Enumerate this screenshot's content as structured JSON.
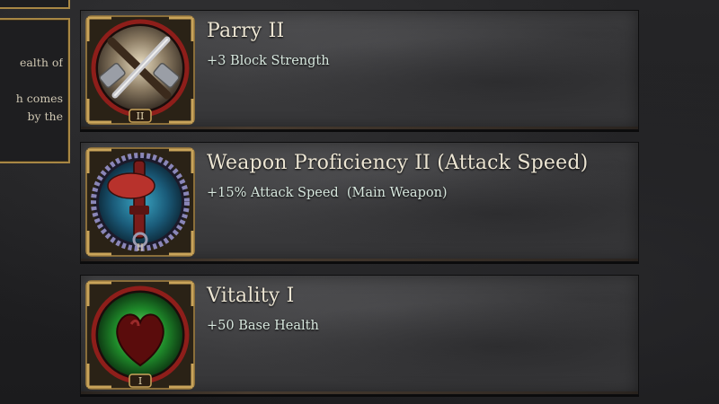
{
  "side_panel": {
    "lines": [
      "ealth of",
      "",
      "h comes",
      "by the"
    ]
  },
  "skills": [
    {
      "title": "Parry II",
      "effect": "+3 Block Strength",
      "icon": "crossed-hammer-sword-icon",
      "rank": "II"
    },
    {
      "title": "Weapon Proficiency II (Attack Speed)",
      "effect": "+15% Attack Speed  (Main Weapon)",
      "icon": "gripped-weapon-icon",
      "rank": "II"
    },
    {
      "title": "Vitality I",
      "effect": "+50 Base Health",
      "icon": "heart-icon",
      "rank": "I"
    }
  ],
  "colors": {
    "frame_gold": "#a88744",
    "ring_red": "#8e1e1a",
    "title_text": "#ece5d3",
    "effect_text": "#d8e8df"
  }
}
